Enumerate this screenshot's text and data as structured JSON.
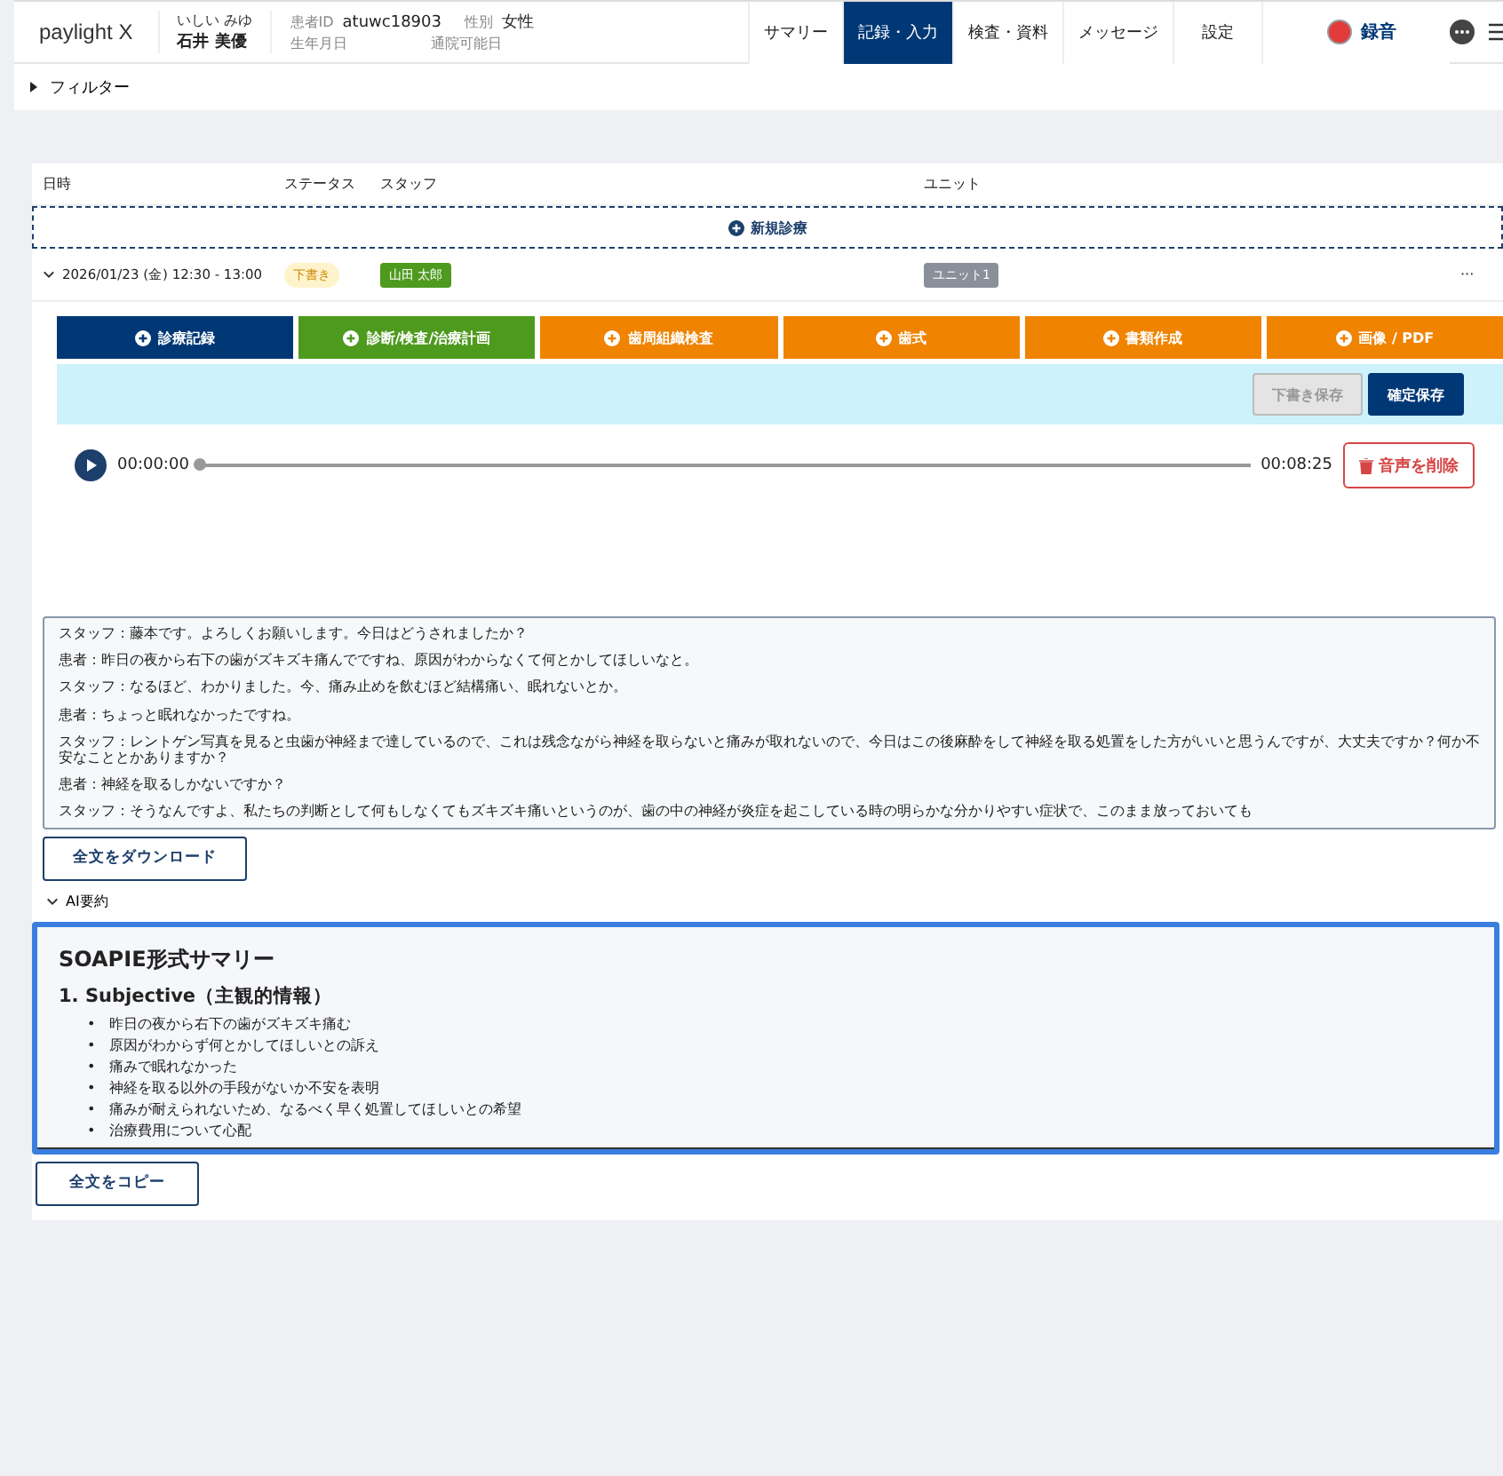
{
  "header": {
    "logo": "paylight X",
    "patient": {
      "kana": "いしい みゆ",
      "name": "石井 美優"
    },
    "fields": [
      {
        "label": "患者ID",
        "value": "atuwc18903"
      },
      {
        "label": "性別",
        "value": "女性"
      }
    ],
    "subfields": [
      "生年月日",
      "通院可能日"
    ],
    "tabs": [
      {
        "label": "サマリー",
        "selected": false
      },
      {
        "label": "記録・入力",
        "selected": true
      },
      {
        "label": "検査・資料",
        "selected": false
      },
      {
        "label": "メッセージ",
        "selected": false
      },
      {
        "label": "設定",
        "selected": false
      }
    ],
    "record_button": {
      "label": "録音"
    }
  },
  "filter": {
    "label": "フィルター",
    "expanded": false
  },
  "table": {
    "columns": [
      "日時",
      "ステータス",
      "スタッフ",
      "ユニット"
    ],
    "new_row": {
      "label": "新規診療"
    },
    "rows": [
      {
        "datetime": "2026/01/23 (金) 12:30 - 13:00",
        "expanded": true,
        "status": "下書き",
        "staff": "山田 太郎",
        "unit": "ユニット1",
        "more": "···"
      }
    ]
  },
  "actions": [
    {
      "label": "診療記録",
      "color": "#003876"
    },
    {
      "label": "診断/検査/治療計画",
      "color": "#4e9a1e"
    },
    {
      "label": "歯周組織検査",
      "color": "#f08300"
    },
    {
      "label": "歯式",
      "color": "#f08300"
    },
    {
      "label": "書類作成",
      "color": "#f08300"
    },
    {
      "label": "画像 / PDF",
      "color": "#f08300"
    }
  ],
  "save_bar": {
    "draft": {
      "label": "下書き保存",
      "disabled": true
    },
    "confirm": {
      "label": "確定保存",
      "disabled": false
    }
  },
  "player": {
    "current": "00:00:00",
    "level": 0,
    "total": "00:08:25",
    "delete_label": "音声を削除"
  },
  "transcript": [
    "スタッフ：藤本です。よろしくお願いします。今日はどうされましたか？",
    "患者：昨日の夜から右下の歯がズキズキ痛んでですね、原因がわからなくて何とかしてほしいなと。",
    "スタッフ：なるほど、わかりました。今、痛み止めを飲むほど結構痛い、眠れないとか。",
    "患者：ちょっと眠れなかったですね。",
    "スタッフ：レントゲン写真を見ると虫歯が神経まで達しているので、これは残念ながら神経を取らないと痛みが取れないので、今日はこの後麻酔をして神経を取る処置をした方がいいと思うんですが、大丈夫ですか？何か不安なこととかありますか？",
    "患者：神経を取るしかないですか？",
    "スタッフ：そうなんですよ、私たちの判断として何もしなくてもズキズキ痛いというのが、歯の中の神経が炎症を起こしている時の明らかな分かりやすい症状で、このまま放っておいても"
  ],
  "download_label": "全文をダウンロード",
  "ai_summary": {
    "label": "AI要約",
    "expanded": true,
    "title": "SOAPIE形式サマリー",
    "section": "1. Subjective（主観的情報）",
    "bullets": [
      {
        "marker": "•",
        "text": "昨日の夜から右下の歯がズキズキ痛む"
      },
      {
        "marker": "•",
        "text": "原因がわからず何とかしてほしいとの訴え"
      },
      {
        "marker": "•",
        "text": "痛みで眠れなかった"
      },
      {
        "marker": "•",
        "text": "神経を取る以外の手段がないか不安を表明"
      },
      {
        "marker": "•",
        "text": "痛みが耐えられないため、なるべく早く処置してほしいとの希望"
      },
      {
        "marker": "•",
        "text": "治療費用について心配"
      }
    ],
    "copy_label": "全文をコピー"
  }
}
